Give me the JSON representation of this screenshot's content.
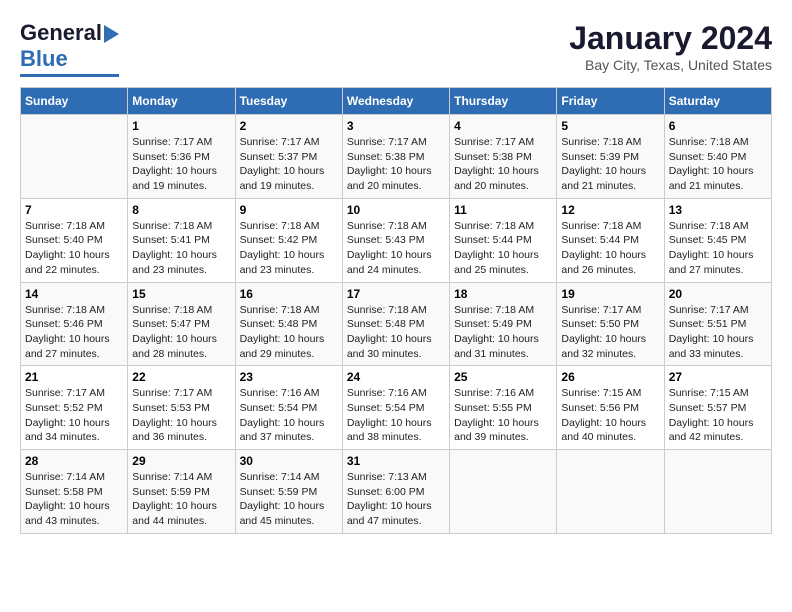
{
  "header": {
    "logo_general": "General",
    "logo_blue": "Blue",
    "title": "January 2024",
    "subtitle": "Bay City, Texas, United States"
  },
  "calendar": {
    "days_of_week": [
      "Sunday",
      "Monday",
      "Tuesday",
      "Wednesday",
      "Thursday",
      "Friday",
      "Saturday"
    ],
    "weeks": [
      [
        {
          "day": "",
          "info": ""
        },
        {
          "day": "1",
          "info": "Sunrise: 7:17 AM\nSunset: 5:36 PM\nDaylight: 10 hours\nand 19 minutes."
        },
        {
          "day": "2",
          "info": "Sunrise: 7:17 AM\nSunset: 5:37 PM\nDaylight: 10 hours\nand 19 minutes."
        },
        {
          "day": "3",
          "info": "Sunrise: 7:17 AM\nSunset: 5:38 PM\nDaylight: 10 hours\nand 20 minutes."
        },
        {
          "day": "4",
          "info": "Sunrise: 7:17 AM\nSunset: 5:38 PM\nDaylight: 10 hours\nand 20 minutes."
        },
        {
          "day": "5",
          "info": "Sunrise: 7:18 AM\nSunset: 5:39 PM\nDaylight: 10 hours\nand 21 minutes."
        },
        {
          "day": "6",
          "info": "Sunrise: 7:18 AM\nSunset: 5:40 PM\nDaylight: 10 hours\nand 21 minutes."
        }
      ],
      [
        {
          "day": "7",
          "info": "Sunrise: 7:18 AM\nSunset: 5:40 PM\nDaylight: 10 hours\nand 22 minutes."
        },
        {
          "day": "8",
          "info": "Sunrise: 7:18 AM\nSunset: 5:41 PM\nDaylight: 10 hours\nand 23 minutes."
        },
        {
          "day": "9",
          "info": "Sunrise: 7:18 AM\nSunset: 5:42 PM\nDaylight: 10 hours\nand 23 minutes."
        },
        {
          "day": "10",
          "info": "Sunrise: 7:18 AM\nSunset: 5:43 PM\nDaylight: 10 hours\nand 24 minutes."
        },
        {
          "day": "11",
          "info": "Sunrise: 7:18 AM\nSunset: 5:44 PM\nDaylight: 10 hours\nand 25 minutes."
        },
        {
          "day": "12",
          "info": "Sunrise: 7:18 AM\nSunset: 5:44 PM\nDaylight: 10 hours\nand 26 minutes."
        },
        {
          "day": "13",
          "info": "Sunrise: 7:18 AM\nSunset: 5:45 PM\nDaylight: 10 hours\nand 27 minutes."
        }
      ],
      [
        {
          "day": "14",
          "info": "Sunrise: 7:18 AM\nSunset: 5:46 PM\nDaylight: 10 hours\nand 27 minutes."
        },
        {
          "day": "15",
          "info": "Sunrise: 7:18 AM\nSunset: 5:47 PM\nDaylight: 10 hours\nand 28 minutes."
        },
        {
          "day": "16",
          "info": "Sunrise: 7:18 AM\nSunset: 5:48 PM\nDaylight: 10 hours\nand 29 minutes."
        },
        {
          "day": "17",
          "info": "Sunrise: 7:18 AM\nSunset: 5:48 PM\nDaylight: 10 hours\nand 30 minutes."
        },
        {
          "day": "18",
          "info": "Sunrise: 7:18 AM\nSunset: 5:49 PM\nDaylight: 10 hours\nand 31 minutes."
        },
        {
          "day": "19",
          "info": "Sunrise: 7:17 AM\nSunset: 5:50 PM\nDaylight: 10 hours\nand 32 minutes."
        },
        {
          "day": "20",
          "info": "Sunrise: 7:17 AM\nSunset: 5:51 PM\nDaylight: 10 hours\nand 33 minutes."
        }
      ],
      [
        {
          "day": "21",
          "info": "Sunrise: 7:17 AM\nSunset: 5:52 PM\nDaylight: 10 hours\nand 34 minutes."
        },
        {
          "day": "22",
          "info": "Sunrise: 7:17 AM\nSunset: 5:53 PM\nDaylight: 10 hours\nand 36 minutes."
        },
        {
          "day": "23",
          "info": "Sunrise: 7:16 AM\nSunset: 5:54 PM\nDaylight: 10 hours\nand 37 minutes."
        },
        {
          "day": "24",
          "info": "Sunrise: 7:16 AM\nSunset: 5:54 PM\nDaylight: 10 hours\nand 38 minutes."
        },
        {
          "day": "25",
          "info": "Sunrise: 7:16 AM\nSunset: 5:55 PM\nDaylight: 10 hours\nand 39 minutes."
        },
        {
          "day": "26",
          "info": "Sunrise: 7:15 AM\nSunset: 5:56 PM\nDaylight: 10 hours\nand 40 minutes."
        },
        {
          "day": "27",
          "info": "Sunrise: 7:15 AM\nSunset: 5:57 PM\nDaylight: 10 hours\nand 42 minutes."
        }
      ],
      [
        {
          "day": "28",
          "info": "Sunrise: 7:14 AM\nSunset: 5:58 PM\nDaylight: 10 hours\nand 43 minutes."
        },
        {
          "day": "29",
          "info": "Sunrise: 7:14 AM\nSunset: 5:59 PM\nDaylight: 10 hours\nand 44 minutes."
        },
        {
          "day": "30",
          "info": "Sunrise: 7:14 AM\nSunset: 5:59 PM\nDaylight: 10 hours\nand 45 minutes."
        },
        {
          "day": "31",
          "info": "Sunrise: 7:13 AM\nSunset: 6:00 PM\nDaylight: 10 hours\nand 47 minutes."
        },
        {
          "day": "",
          "info": ""
        },
        {
          "day": "",
          "info": ""
        },
        {
          "day": "",
          "info": ""
        }
      ]
    ]
  }
}
